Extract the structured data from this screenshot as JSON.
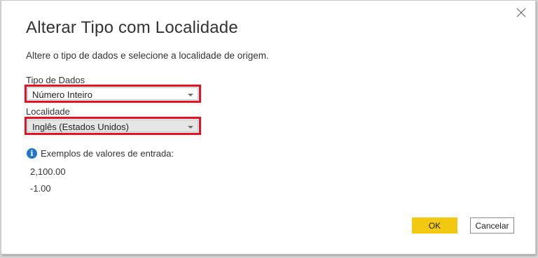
{
  "dialog": {
    "title": "Alterar Tipo com Localidade",
    "subtitle": "Altere o tipo de dados e selecione a localidade de origem.",
    "close_icon": "close-icon"
  },
  "data_type": {
    "label": "Tipo de Dados",
    "value": "Número Inteiro"
  },
  "locale": {
    "label": "Localidade",
    "value": "Inglês (Estados Unidos)"
  },
  "examples": {
    "info_icon": "info-icon",
    "heading": "Exemplos de valores de entrada:",
    "values": [
      "2,100.00",
      "-1.00"
    ]
  },
  "buttons": {
    "ok": "OK",
    "cancel": "Cancelar"
  },
  "colors": {
    "ok_button": "#f2c811",
    "highlight_border": "#e81123",
    "info_icon": "#1f77c6"
  }
}
